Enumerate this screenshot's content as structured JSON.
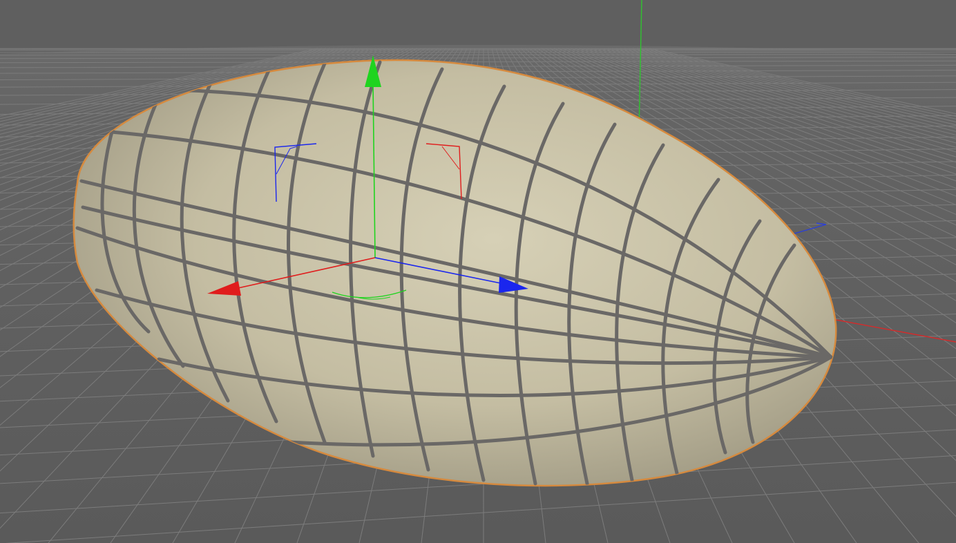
{
  "viewport": {
    "view": "perspective",
    "background_color": "#5f5f5f",
    "grid_color": "#7c7c7c"
  },
  "world_axes": {
    "x_color": "#d42b2b",
    "y_color": "#2fc42f",
    "z_color": "#2b3fd8"
  },
  "object": {
    "shape": "ellipsoid",
    "selected": true,
    "surface_color": "#c4bda2",
    "wire_color": "#6a6866",
    "outline_color": "#d68a3e"
  },
  "gizmo": {
    "mode": "move",
    "x_color": "#e01c1c",
    "y_color": "#1fd41f",
    "z_color": "#1a26ee",
    "plane_handles": [
      "xy-plane",
      "yz-plane",
      "xz-plane"
    ]
  }
}
